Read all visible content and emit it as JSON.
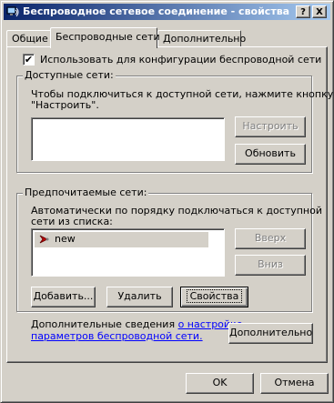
{
  "window": {
    "title": "Беспроводное сетевое соединение - свойства",
    "help_button": "?",
    "close_button": "X"
  },
  "tabs": [
    {
      "label": "Общие"
    },
    {
      "label": "Беспроводные сети"
    },
    {
      "label": "Дополнительно"
    }
  ],
  "use_windows_checkbox": {
    "label": "Использовать для конфигурации беспроводной сети",
    "checked": true,
    "mark": "✔"
  },
  "available": {
    "group_label": "Доступные сети:",
    "description_line1": "Чтобы подключиться к доступной сети, нажмите кнопку",
    "description_line2": "\"Настроить\".",
    "configure_button": "Настроить",
    "refresh_button": "Обновить"
  },
  "preferred": {
    "group_label": "Предпочитаемые сети:",
    "description_line1": "Автоматически по порядку подключаться к доступной",
    "description_line2": "сети из списка:",
    "networks": [
      {
        "name": "new",
        "icon": "wireless-network-icon"
      }
    ],
    "up_button": "Вверх",
    "down_button": "Вниз",
    "add_button": "Добавить...",
    "remove_button": "Удалить",
    "properties_button": "Свойства"
  },
  "more_info": {
    "text": "Дополнительные сведения",
    "link_line1": "о настройке",
    "link_line2": "параметров беспроводной сети.",
    "advanced_button": "Дополнительно"
  },
  "footer": {
    "ok_button": "OK",
    "cancel_button": "Отмена"
  },
  "colors": {
    "titlebar_start": "#0a246a",
    "titlebar_end": "#a6caf0",
    "dialog_face": "#d4d0c8",
    "link": "#0000ff"
  }
}
